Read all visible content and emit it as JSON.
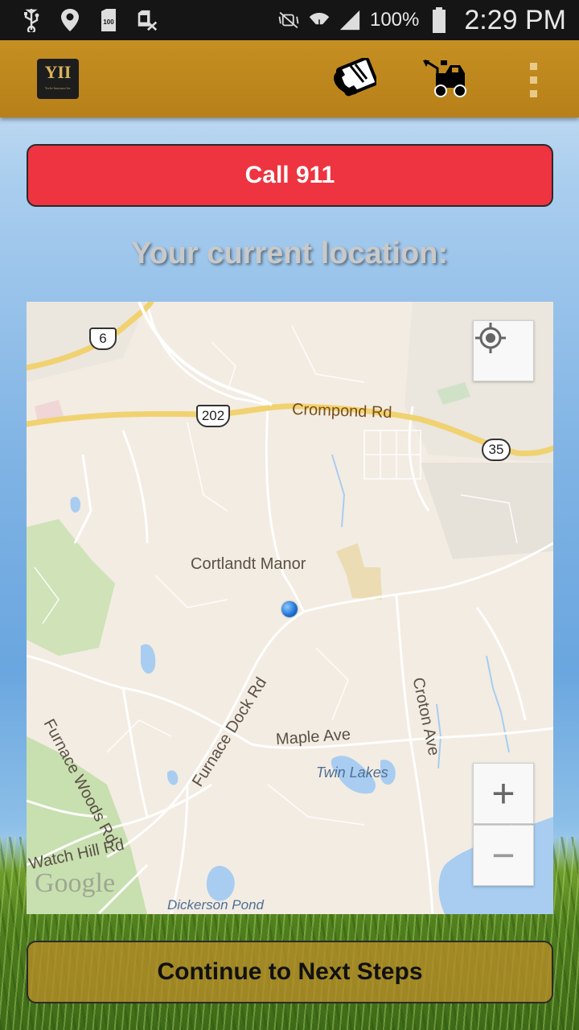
{
  "status_bar": {
    "icons": [
      "usb-icon",
      "location-pin-icon",
      "sd-card-icon",
      "no-sim-icon",
      "mute-icon",
      "wifi-icon",
      "signal-icon",
      "battery-icon"
    ],
    "sd_card_label": "100",
    "battery_percent": "100%",
    "time": "2:29 PM"
  },
  "app_bar": {
    "logo_text": "YII",
    "logo_subtext": "Yorke Insurance Inc",
    "actions": [
      "phone-call-icon",
      "tow-truck-icon",
      "overflow-menu-icon"
    ],
    "brand_color": "#c58f22"
  },
  "call_button": {
    "label": "Call 911",
    "color": "#ed3440"
  },
  "location_title": "Your current location:",
  "map": {
    "place_labels": {
      "crompond": "Crompond Rd",
      "cortlandt": "Cortlandt Manor",
      "furnace_woods": "Furnace Woods Rd",
      "furnace_dock": "Furnace Dock Rd",
      "maple": "Maple Ave",
      "croton": "Croton Ave",
      "twin_lakes": "Twin Lakes",
      "watch_hill": "Watch Hill Rd",
      "dickerson": "Dickerson Pond"
    },
    "route_shields": {
      "r6": "6",
      "r202": "202",
      "r35": "35"
    },
    "attribution": "Google",
    "zoom_in": "+",
    "zoom_out": "−"
  },
  "next_button": {
    "label": "Continue to Next Steps"
  }
}
